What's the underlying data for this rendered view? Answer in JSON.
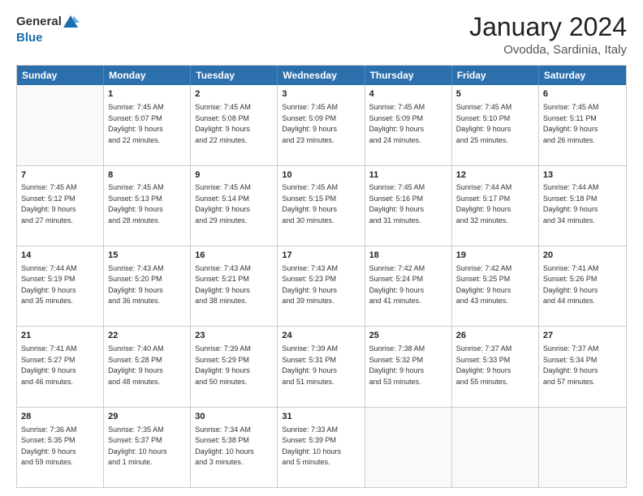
{
  "header": {
    "logo_general": "General",
    "logo_blue": "Blue",
    "title": "January 2024",
    "location": "Ovodda, Sardinia, Italy"
  },
  "calendar": {
    "days": [
      "Sunday",
      "Monday",
      "Tuesday",
      "Wednesday",
      "Thursday",
      "Friday",
      "Saturday"
    ],
    "rows": [
      [
        {
          "day": "",
          "content": ""
        },
        {
          "day": "1",
          "content": "Sunrise: 7:45 AM\nSunset: 5:07 PM\nDaylight: 9 hours\nand 22 minutes."
        },
        {
          "day": "2",
          "content": "Sunrise: 7:45 AM\nSunset: 5:08 PM\nDaylight: 9 hours\nand 22 minutes."
        },
        {
          "day": "3",
          "content": "Sunrise: 7:45 AM\nSunset: 5:09 PM\nDaylight: 9 hours\nand 23 minutes."
        },
        {
          "day": "4",
          "content": "Sunrise: 7:45 AM\nSunset: 5:09 PM\nDaylight: 9 hours\nand 24 minutes."
        },
        {
          "day": "5",
          "content": "Sunrise: 7:45 AM\nSunset: 5:10 PM\nDaylight: 9 hours\nand 25 minutes."
        },
        {
          "day": "6",
          "content": "Sunrise: 7:45 AM\nSunset: 5:11 PM\nDaylight: 9 hours\nand 26 minutes."
        }
      ],
      [
        {
          "day": "7",
          "content": "Sunrise: 7:45 AM\nSunset: 5:12 PM\nDaylight: 9 hours\nand 27 minutes."
        },
        {
          "day": "8",
          "content": "Sunrise: 7:45 AM\nSunset: 5:13 PM\nDaylight: 9 hours\nand 28 minutes."
        },
        {
          "day": "9",
          "content": "Sunrise: 7:45 AM\nSunset: 5:14 PM\nDaylight: 9 hours\nand 29 minutes."
        },
        {
          "day": "10",
          "content": "Sunrise: 7:45 AM\nSunset: 5:15 PM\nDaylight: 9 hours\nand 30 minutes."
        },
        {
          "day": "11",
          "content": "Sunrise: 7:45 AM\nSunset: 5:16 PM\nDaylight: 9 hours\nand 31 minutes."
        },
        {
          "day": "12",
          "content": "Sunrise: 7:44 AM\nSunset: 5:17 PM\nDaylight: 9 hours\nand 32 minutes."
        },
        {
          "day": "13",
          "content": "Sunrise: 7:44 AM\nSunset: 5:18 PM\nDaylight: 9 hours\nand 34 minutes."
        }
      ],
      [
        {
          "day": "14",
          "content": "Sunrise: 7:44 AM\nSunset: 5:19 PM\nDaylight: 9 hours\nand 35 minutes."
        },
        {
          "day": "15",
          "content": "Sunrise: 7:43 AM\nSunset: 5:20 PM\nDaylight: 9 hours\nand 36 minutes."
        },
        {
          "day": "16",
          "content": "Sunrise: 7:43 AM\nSunset: 5:21 PM\nDaylight: 9 hours\nand 38 minutes."
        },
        {
          "day": "17",
          "content": "Sunrise: 7:43 AM\nSunset: 5:23 PM\nDaylight: 9 hours\nand 39 minutes."
        },
        {
          "day": "18",
          "content": "Sunrise: 7:42 AM\nSunset: 5:24 PM\nDaylight: 9 hours\nand 41 minutes."
        },
        {
          "day": "19",
          "content": "Sunrise: 7:42 AM\nSunset: 5:25 PM\nDaylight: 9 hours\nand 43 minutes."
        },
        {
          "day": "20",
          "content": "Sunrise: 7:41 AM\nSunset: 5:26 PM\nDaylight: 9 hours\nand 44 minutes."
        }
      ],
      [
        {
          "day": "21",
          "content": "Sunrise: 7:41 AM\nSunset: 5:27 PM\nDaylight: 9 hours\nand 46 minutes."
        },
        {
          "day": "22",
          "content": "Sunrise: 7:40 AM\nSunset: 5:28 PM\nDaylight: 9 hours\nand 48 minutes."
        },
        {
          "day": "23",
          "content": "Sunrise: 7:39 AM\nSunset: 5:29 PM\nDaylight: 9 hours\nand 50 minutes."
        },
        {
          "day": "24",
          "content": "Sunrise: 7:39 AM\nSunset: 5:31 PM\nDaylight: 9 hours\nand 51 minutes."
        },
        {
          "day": "25",
          "content": "Sunrise: 7:38 AM\nSunset: 5:32 PM\nDaylight: 9 hours\nand 53 minutes."
        },
        {
          "day": "26",
          "content": "Sunrise: 7:37 AM\nSunset: 5:33 PM\nDaylight: 9 hours\nand 55 minutes."
        },
        {
          "day": "27",
          "content": "Sunrise: 7:37 AM\nSunset: 5:34 PM\nDaylight: 9 hours\nand 57 minutes."
        }
      ],
      [
        {
          "day": "28",
          "content": "Sunrise: 7:36 AM\nSunset: 5:35 PM\nDaylight: 9 hours\nand 59 minutes."
        },
        {
          "day": "29",
          "content": "Sunrise: 7:35 AM\nSunset: 5:37 PM\nDaylight: 10 hours\nand 1 minute."
        },
        {
          "day": "30",
          "content": "Sunrise: 7:34 AM\nSunset: 5:38 PM\nDaylight: 10 hours\nand 3 minutes."
        },
        {
          "day": "31",
          "content": "Sunrise: 7:33 AM\nSunset: 5:39 PM\nDaylight: 10 hours\nand 5 minutes."
        },
        {
          "day": "",
          "content": ""
        },
        {
          "day": "",
          "content": ""
        },
        {
          "day": "",
          "content": ""
        }
      ]
    ]
  }
}
